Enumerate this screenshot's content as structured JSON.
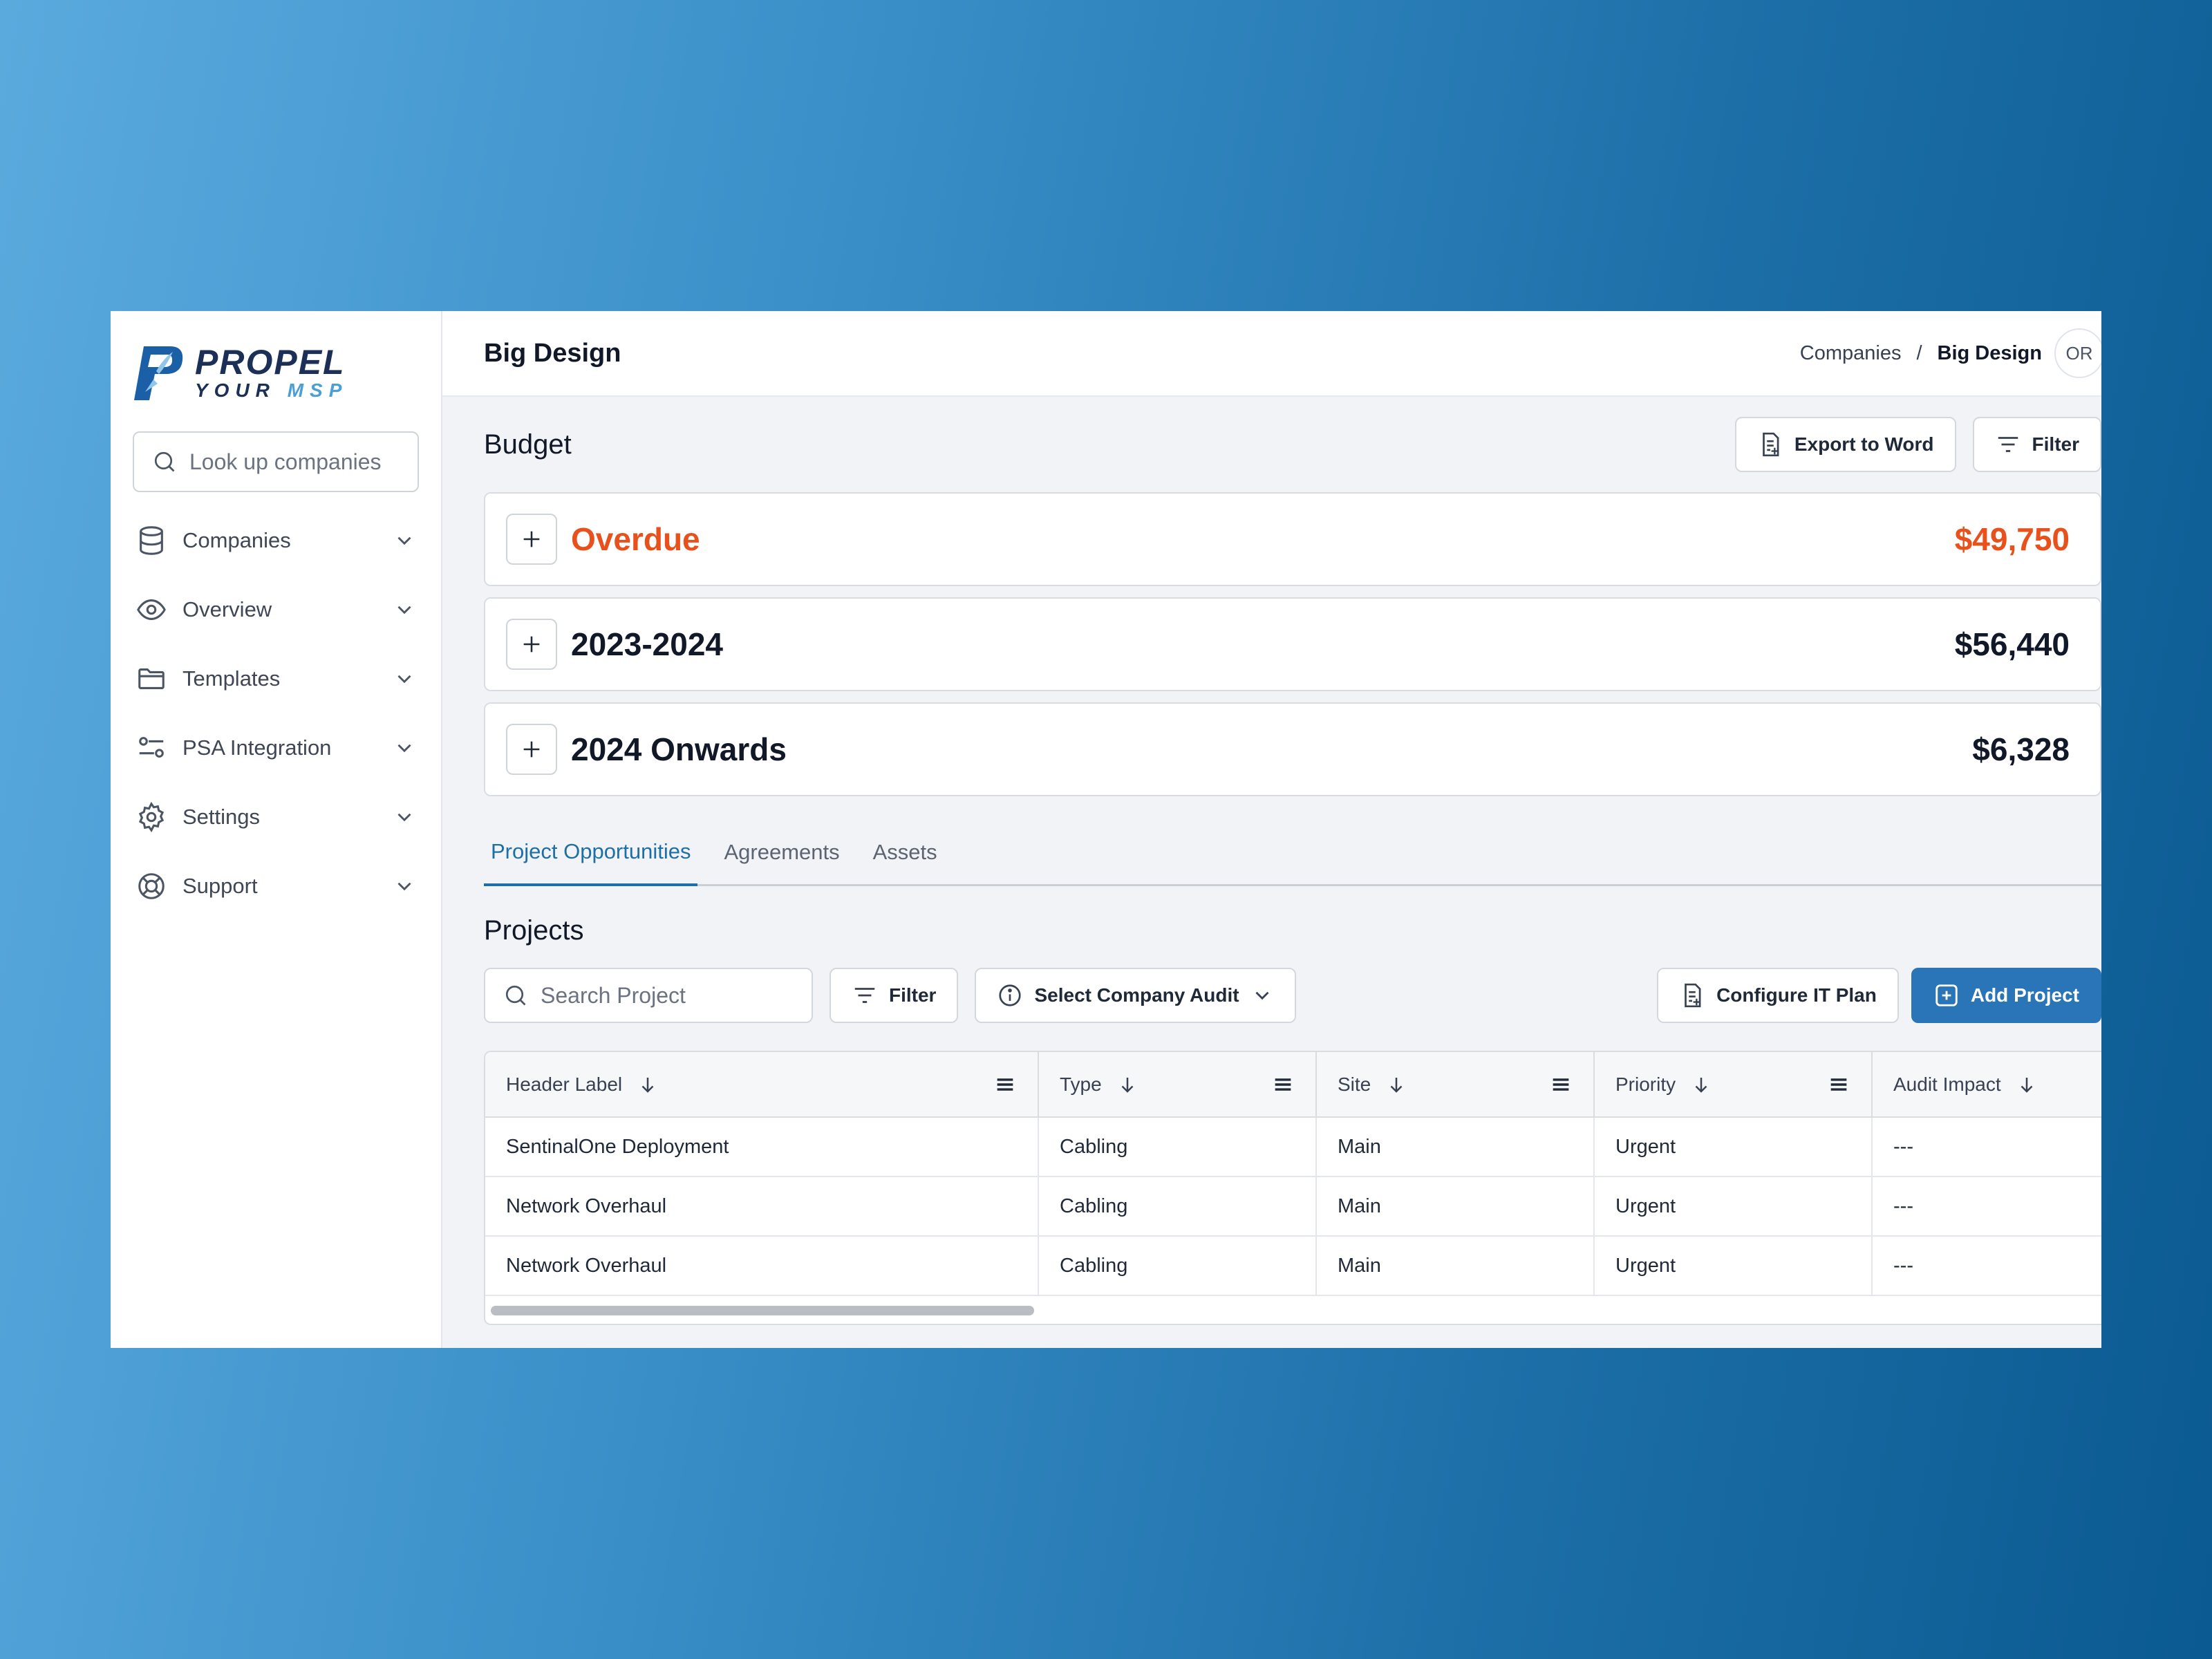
{
  "colors": {
    "accent": "#1e6fa5",
    "primary_button": "#2a74b8",
    "overdue": "#e8501c",
    "brand_navy": "#1b2f57",
    "brand_light": "#4a9fd6"
  },
  "brand": {
    "line1": "PROPEL",
    "line2a": "YOUR",
    "line2b": "MSP"
  },
  "sidebar": {
    "search_placeholder": "Look up companies",
    "items": [
      {
        "label": "Companies",
        "icon": "database-icon"
      },
      {
        "label": "Overview",
        "icon": "eye-icon"
      },
      {
        "label": "Templates",
        "icon": "folder-icon"
      },
      {
        "label": "PSA Integration",
        "icon": "sliders-icon"
      },
      {
        "label": "Settings",
        "icon": "gear-icon"
      },
      {
        "label": "Support",
        "icon": "lifebuoy-icon"
      }
    ]
  },
  "header": {
    "title": "Big Design",
    "breadcrumb": [
      "Companies",
      "/",
      "Big Design"
    ],
    "avatar": "OR"
  },
  "budget": {
    "heading": "Budget",
    "export_label": "Export to Word",
    "filter_label": "Filter",
    "rows": [
      {
        "name": "Overdue",
        "amount": "$49,750",
        "status": "overdue"
      },
      {
        "name": "2023-2024",
        "amount": "$56,440"
      },
      {
        "name": "2024 Onwards",
        "amount": "$6,328"
      }
    ]
  },
  "tabs": [
    "Project Opportunities",
    "Agreements",
    "Assets"
  ],
  "active_tab": "Project Opportunities",
  "projects": {
    "heading": "Projects",
    "search_placeholder": "Search Project",
    "filter_label": "Filter",
    "audit_select": "Select Company Audit",
    "configure_label": "Configure IT Plan",
    "add_label": "Add Project",
    "columns": [
      "Header Label",
      "Type",
      "Site",
      "Priority",
      "Audit Impact"
    ],
    "rows": [
      [
        "SentinalOne Deployment",
        "Cabling",
        "Main",
        "Urgent",
        "---"
      ],
      [
        "Network Overhaul",
        "Cabling",
        "Main",
        "Urgent",
        "---"
      ],
      [
        "Network Overhaul",
        "Cabling",
        "Main",
        "Urgent",
        "---"
      ]
    ]
  }
}
